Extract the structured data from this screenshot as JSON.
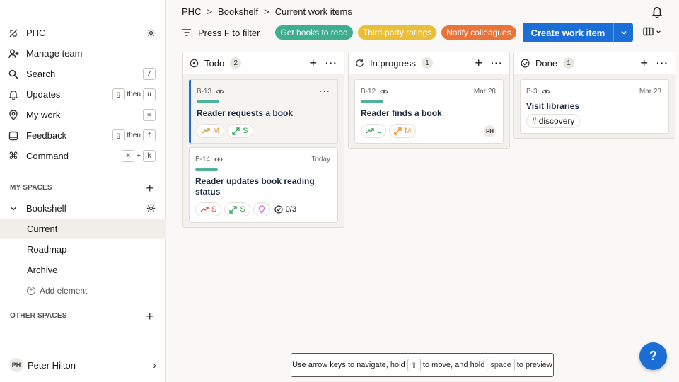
{
  "sidebar": {
    "workspace": "PHC",
    "nav": [
      {
        "label": "Manage team"
      },
      {
        "label": "Search",
        "keys": [
          "/"
        ]
      },
      {
        "label": "Updates",
        "keys": [
          "g",
          "then",
          "u"
        ]
      },
      {
        "label": "My work",
        "keys": [
          "="
        ]
      },
      {
        "label": "Feedback",
        "keys": [
          "g",
          "then",
          "f"
        ]
      },
      {
        "label": "Command",
        "keys": [
          "⌘",
          "+",
          "k"
        ]
      }
    ],
    "my_spaces_title": "MY SPACES",
    "space_name": "Bookshelf",
    "space_items": [
      "Current",
      "Roadmap",
      "Archive"
    ],
    "add_element": "Add element",
    "other_spaces_title": "OTHER SPACES",
    "user_initials": "PH",
    "user_name": "Peter Hilton"
  },
  "breadcrumb": [
    "PHC",
    "Bookshelf",
    "Current work items"
  ],
  "toolbar": {
    "filter_label": "Press F to filter",
    "tags": [
      {
        "label": "Get books to read",
        "color": "#3fae8f"
      },
      {
        "label": "Third-party ratings",
        "color": "#e9bf3a"
      },
      {
        "label": "Notify colleagues",
        "color": "#e9743a"
      }
    ],
    "create_label": "Create work item"
  },
  "columns": [
    {
      "title": "Todo",
      "count": "2",
      "cards": [
        {
          "key": "B-13",
          "date": "",
          "name": "Reader requests a book",
          "chips": [
            {
              "icon": "trend",
              "label": "M",
              "color": "#e7902f"
            },
            {
              "icon": "expand",
              "label": "S",
              "color": "#3aa05a"
            }
          ]
        },
        {
          "key": "B-14",
          "date": "Today",
          "name": "Reader updates book reading status",
          "chips": [
            {
              "icon": "trend",
              "label": "S",
              "color": "#e5484d"
            },
            {
              "icon": "expand",
              "label": "S",
              "color": "#3aa05a"
            },
            {
              "icon": "bulb",
              "label": "",
              "color": "#d86fd8"
            }
          ],
          "checklist": "0/3"
        }
      ]
    },
    {
      "title": "In progress",
      "count": "1",
      "cards": [
        {
          "key": "B-12",
          "date": "Mar 28",
          "name": "Reader finds a book",
          "chips": [
            {
              "icon": "trend",
              "label": "L",
              "color": "#3aa05a"
            },
            {
              "icon": "expand",
              "label": "M",
              "color": "#e7902f"
            }
          ],
          "assignee": "PH"
        }
      ]
    },
    {
      "title": "Done",
      "count": "1",
      "cards": [
        {
          "key": "B-3",
          "date": "Mar 28",
          "name": "Visit libraries",
          "tag": "discovery"
        }
      ]
    }
  ],
  "hint": {
    "pre": "Use arrow keys to navigate, hold",
    "key1": "⇧",
    "mid": "to move, and hold",
    "key2": "space",
    "post": "to preview"
  },
  "help_label": "?"
}
